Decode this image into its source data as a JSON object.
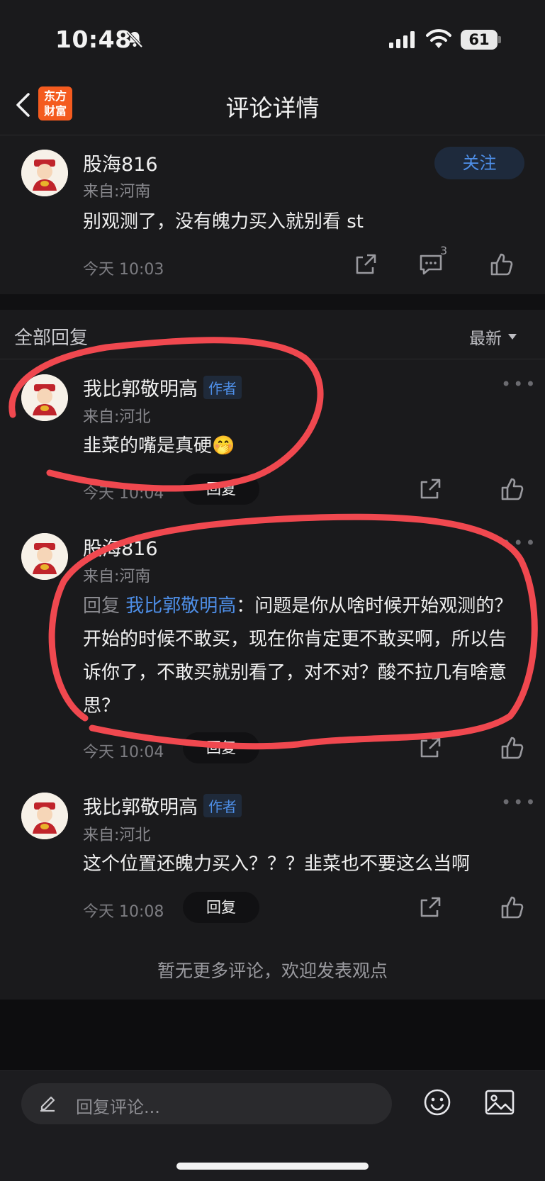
{
  "status_bar": {
    "time": "10:48",
    "battery": "61"
  },
  "nav": {
    "title": "评论详情",
    "logo_line1": "东方",
    "logo_line2": "财富"
  },
  "main_post": {
    "username": "股海816",
    "location": "来自:河南",
    "follow_label": "关注",
    "content": "别观测了，没有魄力买入就别看 st",
    "time": "今天 10:03",
    "comment_count": "3"
  },
  "replies_section": {
    "title": "全部回复",
    "sort_label": "最新"
  },
  "replies": [
    {
      "username": "我比郭敬明高",
      "tag": "作者",
      "location": "来自:河北",
      "content": "韭菜的嘴是真硬",
      "emoji": "🤭",
      "time": "今天 10:04",
      "reply_label": "回复"
    },
    {
      "username": "股海816",
      "location": "来自:河南",
      "reply_prefix": "回复",
      "reply_target": "我比郭敬明高",
      "content": "：问题是你从啥时候开始观测的？开始的时候不敢买，现在你肯定更不敢买啊，所以告诉你了，不敢买就别看了，对不对？酸不拉几有啥意思？",
      "time": "今天 10:04",
      "reply_label": "回复"
    },
    {
      "username": "我比郭敬明高",
      "tag": "作者",
      "location": "来自:河北",
      "content": "这个位置还魄力买入？？？韭菜也不要这么当啊",
      "time": "今天 10:08",
      "reply_label": "回复"
    }
  ],
  "footer": {
    "no_more": "暂无更多评论，欢迎发表观点"
  },
  "composer": {
    "placeholder": "回复评论..."
  }
}
